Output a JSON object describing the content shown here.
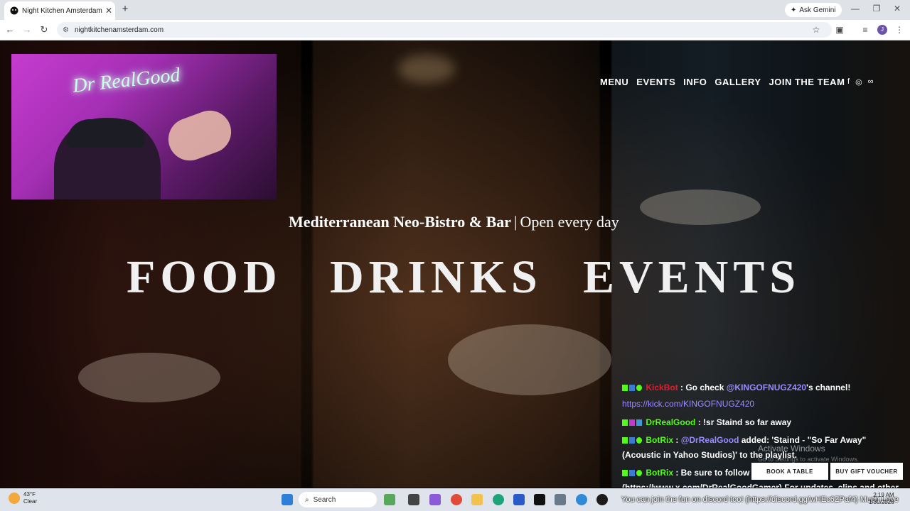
{
  "browser": {
    "tab_title": "Night Kitchen Amsterdam | Me",
    "tab_close": "✕",
    "new_tab": "+",
    "ask_gemini": "Ask Gemini",
    "url": "nightkitchenamsterdam.com",
    "profile_initial": "J",
    "controls": {
      "minimize": "—",
      "restore": "❐",
      "close": "✕"
    }
  },
  "site": {
    "nav": [
      "MENU",
      "EVENTS",
      "INFO",
      "GALLERY",
      "JOIN THE TEAM"
    ],
    "social_icons": [
      "facebook-icon",
      "instagram-icon",
      "tripadvisor-icon"
    ],
    "tagline_bold": "Mediterranean Neo-Bistro & Bar",
    "tagline_sep": "|",
    "tagline_rest": "Open every day",
    "hero": [
      "FOOD",
      "DRINKS",
      "EVENTS"
    ],
    "buttons": {
      "book": "BOOK A TABLE",
      "gift": "BUY GIFT VOUCHER"
    }
  },
  "webcam": {
    "neon_sign": "Dr RealGood"
  },
  "chat": {
    "messages": [
      {
        "user": "KickBot",
        "text_prefix": " : Go check ",
        "mention": "@KINGOFNUGZ420",
        "text": "'s channel!",
        "link": "https://kick.com/KINGOFNUGZ420"
      },
      {
        "user": "DrRealGood",
        "text": " : !sr Staind so far away"
      },
      {
        "user": "BotRix",
        "text_prefix": " : ",
        "mention": "@DrRealGood",
        "text": " added: 'Staind - \"So Far Away\" (Acoustic in Yahoo Studios)' to the playlist."
      },
      {
        "user": "BotRix",
        "text": " : Be sure to follow us on our socials (https://www.x.com/DrRealGoodGamer) For updates, clips and other cool features!!"
      }
    ]
  },
  "windows": {
    "activate_title": "Activate Windows",
    "activate_sub": "Go to Settings to activate Windows."
  },
  "taskbar": {
    "weather_temp": "43°F",
    "weather_desc": "Clear",
    "search_placeholder": "Search",
    "ticker": "You can join the fun on discord too! (https://discord.gg/wHEc6ZPaf4) Much Love",
    "time": "2:19 AM",
    "date": "1/30/2026"
  },
  "colors": {
    "kickbot": "#e01e2e",
    "kick_green": "#53fc18",
    "mention": "#9b8cff"
  }
}
